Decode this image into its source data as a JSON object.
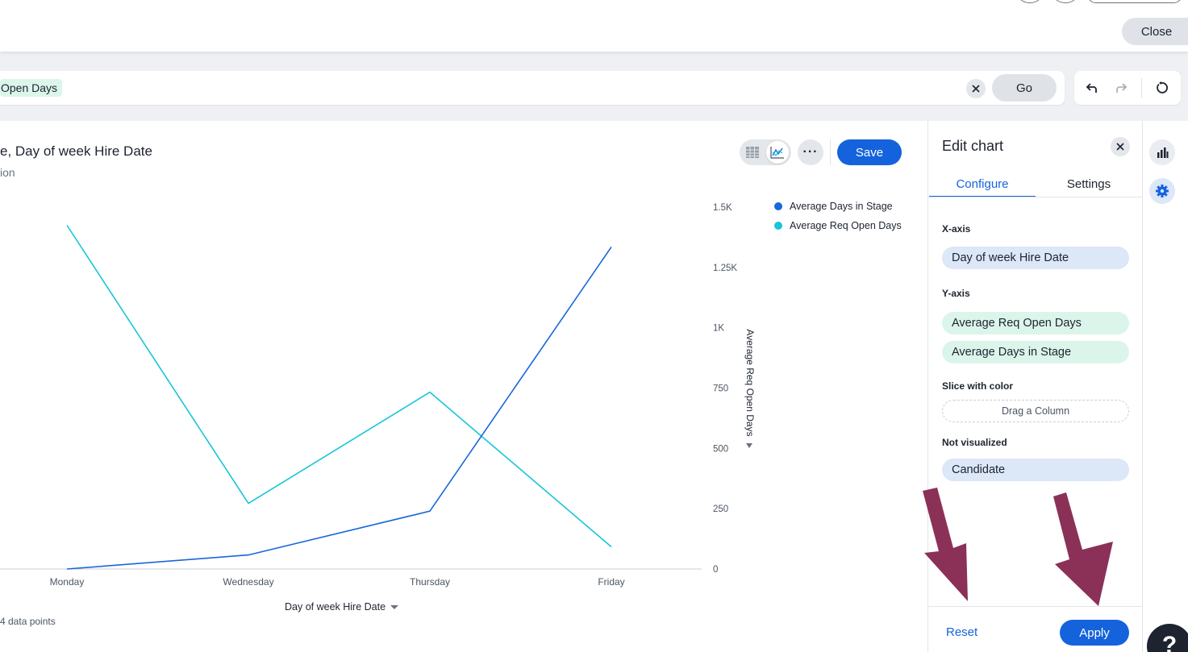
{
  "header": {
    "close_label": "Close"
  },
  "search": {
    "token_label": "Open Days",
    "go_label": "Go",
    "clear_icon": "close-icon"
  },
  "history": {
    "undo_icon": "undo-icon",
    "redo_icon": "redo-icon",
    "reset_icon": "reset-icon"
  },
  "chart_card": {
    "title": "e, Day of week Hire Date",
    "subtitle": "ion",
    "save_label": "Save",
    "more_label": "···",
    "data_points_label": "4 data points",
    "x_axis_title": "Day of week Hire Date",
    "y_axis_title": "Average Req Open Days"
  },
  "chart_data": {
    "type": "line",
    "categories": [
      "Monday",
      "Wednesday",
      "Thursday",
      "Friday"
    ],
    "series": [
      {
        "name": "Average Days in Stage",
        "values": [
          0,
          58,
          240,
          1335
        ],
        "color": "#1a66dd"
      },
      {
        "name": "Average Req Open Days",
        "values": [
          1425,
          272,
          733,
          92
        ],
        "color": "#17c6d8"
      }
    ],
    "y_ticks": [
      "0",
      "250",
      "500",
      "750",
      "1K",
      "1.25K",
      "1.5K"
    ],
    "ylim": [
      0,
      1500
    ],
    "y_axis_side": "right",
    "legend_position": "top-right",
    "grid": false
  },
  "edit_panel": {
    "title": "Edit chart",
    "tabs": [
      "Configure",
      "Settings"
    ],
    "active_tab": "Configure",
    "x_axis_label": "X-axis",
    "x_axis_chips": [
      "Day of week Hire Date"
    ],
    "y_axis_label": "Y-axis",
    "y_axis_chips": [
      "Average Req Open Days",
      "Average Days in Stage"
    ],
    "slice_label": "Slice with color",
    "slice_placeholder": "Drag a Column",
    "not_visualized_label": "Not visualized",
    "not_visualized_chips": [
      "Candidate"
    ],
    "reset_label": "Reset",
    "apply_label": "Apply"
  },
  "help": {
    "label": "?"
  },
  "colors": {
    "primary": "#1463dd",
    "annotation_arrow": "#8b3158",
    "chip_blue": "#dce7f8",
    "chip_green": "#dcf5ea"
  }
}
